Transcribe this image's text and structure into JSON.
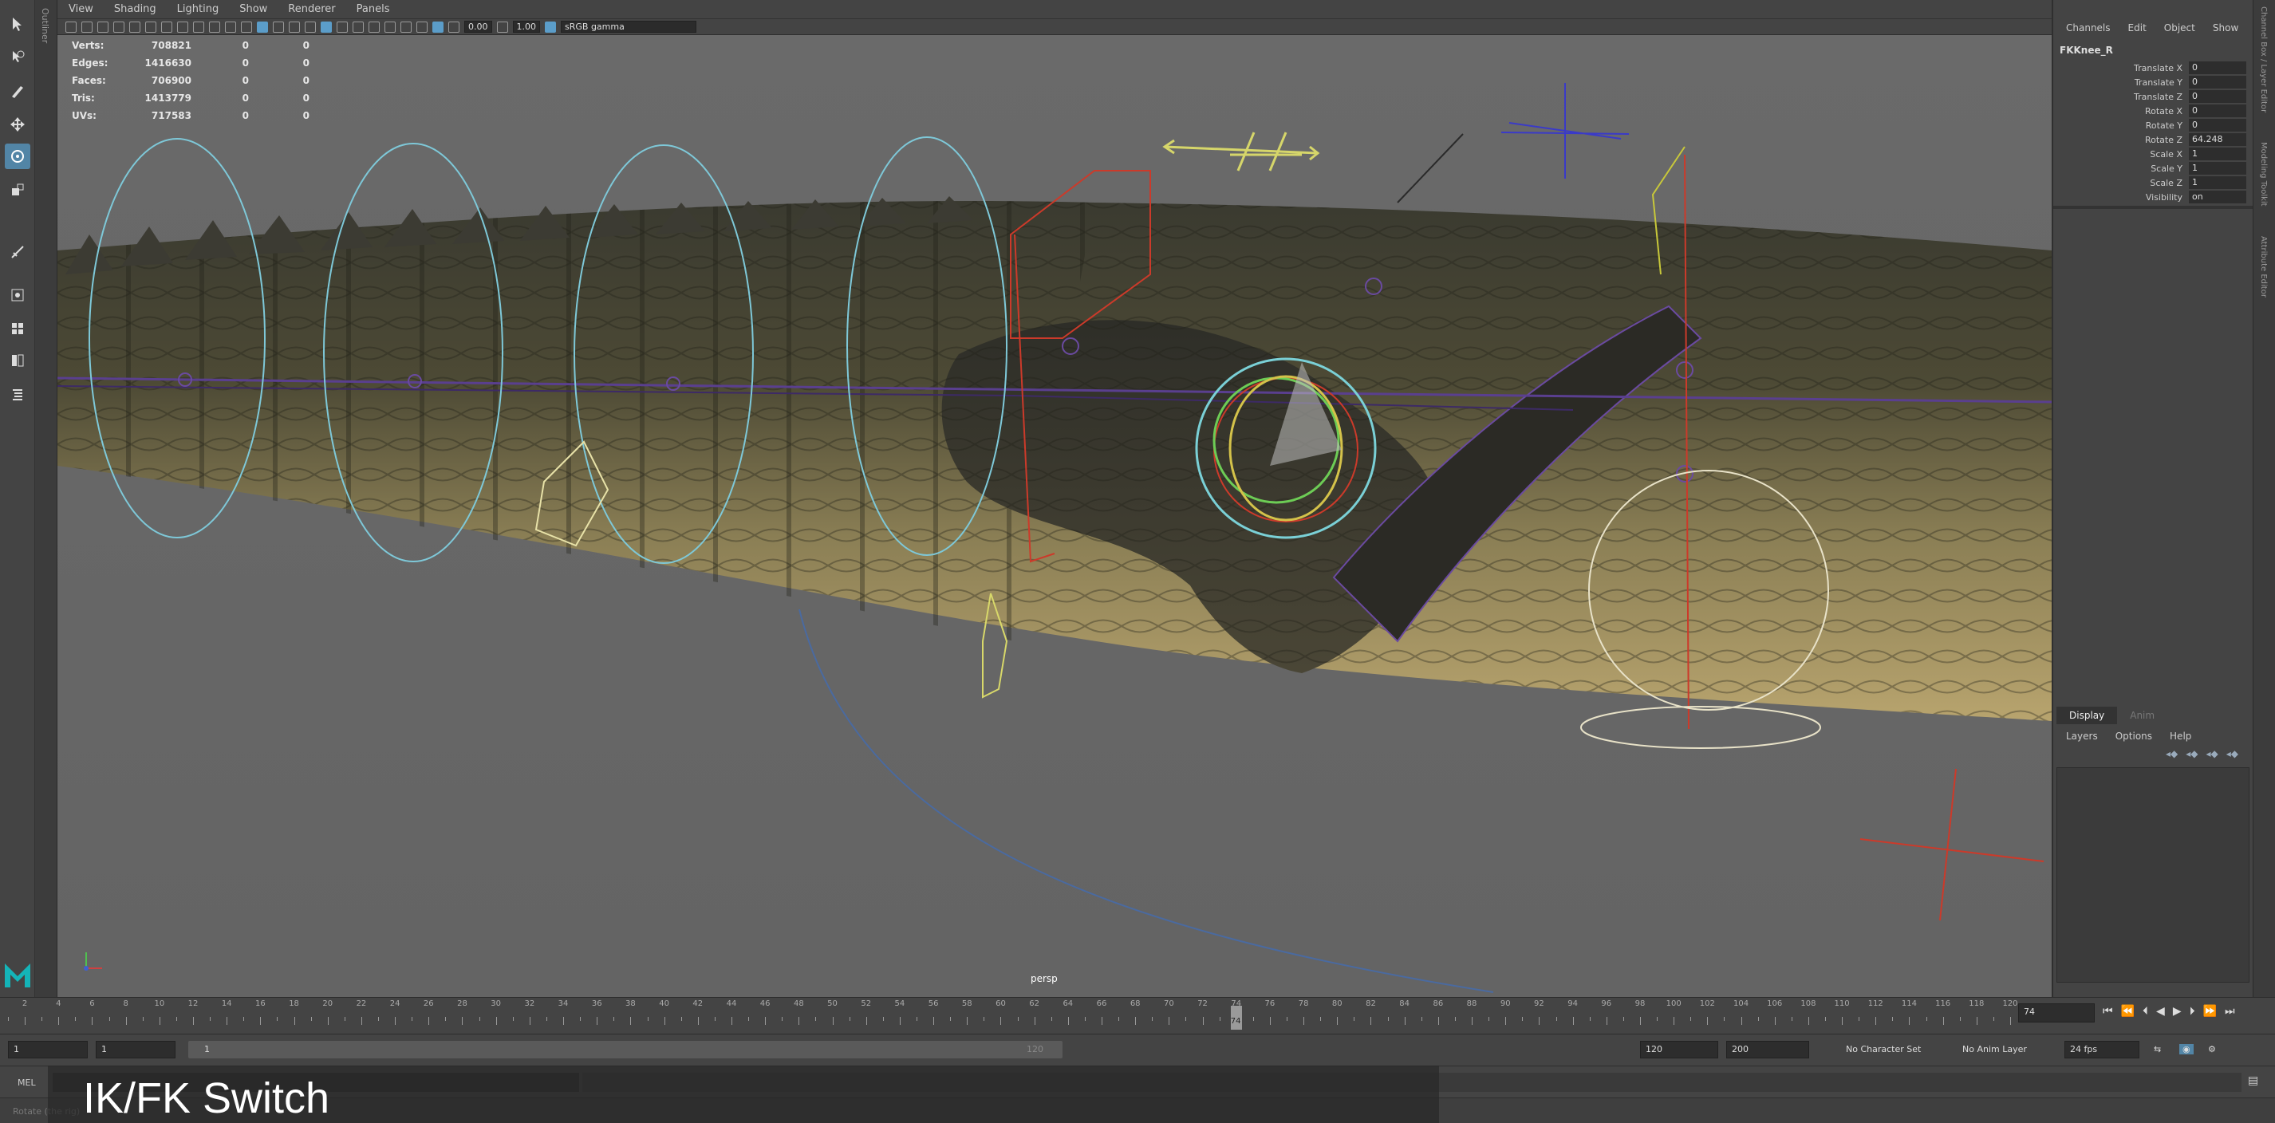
{
  "outliner_tab": "Outliner",
  "viewport": {
    "menu": [
      "View",
      "Shading",
      "Lighting",
      "Show",
      "Renderer",
      "Panels"
    ],
    "toolbar": {
      "exposure": "0.00",
      "gamma": "1.00",
      "color_space": "sRGB gamma"
    },
    "hud": [
      {
        "label": "Verts:",
        "v1": "708821",
        "v2": "0",
        "v3": "0"
      },
      {
        "label": "Edges:",
        "v1": "1416630",
        "v2": "0",
        "v3": "0"
      },
      {
        "label": "Faces:",
        "v1": "706900",
        "v2": "0",
        "v3": "0"
      },
      {
        "label": "Tris:",
        "v1": "1413779",
        "v2": "0",
        "v3": "0"
      },
      {
        "label": "UVs:",
        "v1": "717583",
        "v2": "0",
        "v3": "0"
      }
    ],
    "camera": "persp"
  },
  "channel_box": {
    "menu": [
      "Channels",
      "Edit",
      "Object",
      "Show"
    ],
    "node": "FKKnee_R",
    "attributes": [
      {
        "label": "Translate X",
        "value": "0"
      },
      {
        "label": "Translate Y",
        "value": "0"
      },
      {
        "label": "Translate Z",
        "value": "0"
      },
      {
        "label": "Rotate X",
        "value": "0"
      },
      {
        "label": "Rotate Y",
        "value": "0"
      },
      {
        "label": "Rotate Z",
        "value": "64.248"
      },
      {
        "label": "Scale X",
        "value": "1"
      },
      {
        "label": "Scale Y",
        "value": "1"
      },
      {
        "label": "Scale Z",
        "value": "1"
      },
      {
        "label": "Visibility",
        "value": "on"
      }
    ]
  },
  "side_tabs": [
    "Channel Box / Layer Editor",
    "Modeling Toolkit",
    "Attribute Editor"
  ],
  "layer_editor": {
    "tabs": [
      "Display",
      "Anim"
    ],
    "menu": [
      "Layers",
      "Options",
      "Help"
    ]
  },
  "timeline": {
    "labels": [
      "2",
      "4",
      "6",
      "8",
      "10",
      "12",
      "14",
      "16",
      "18",
      "20",
      "22",
      "24",
      "26",
      "28",
      "30",
      "32",
      "34",
      "36",
      "38",
      "40",
      "42",
      "44",
      "46",
      "48",
      "50",
      "52",
      "54",
      "56",
      "58",
      "60",
      "62",
      "64",
      "66",
      "68",
      "70",
      "72",
      "74",
      "76",
      "78",
      "80",
      "82",
      "84",
      "86",
      "88",
      "90",
      "92",
      "94",
      "96",
      "98",
      "100",
      "102",
      "104",
      "106",
      "108",
      "110",
      "112",
      "114",
      "116",
      "118",
      "120"
    ],
    "current_frame": "74",
    "current_frame_value": 74,
    "start": 1,
    "end": 120
  },
  "range": {
    "start": "1",
    "anim_start": "1",
    "range_start": "1",
    "range_end": "120",
    "end": "120",
    "anim_end": "200",
    "character_set": "No Character Set",
    "anim_layer": "No Anim Layer",
    "fps": "24 fps"
  },
  "command": {
    "label": "MEL",
    "help": "Rotate (the rig)"
  },
  "caption": "IK/FK Switch",
  "colors": {
    "accent": "#5285a6",
    "viewport_bg": "#666666",
    "panel_bg": "#444444"
  }
}
